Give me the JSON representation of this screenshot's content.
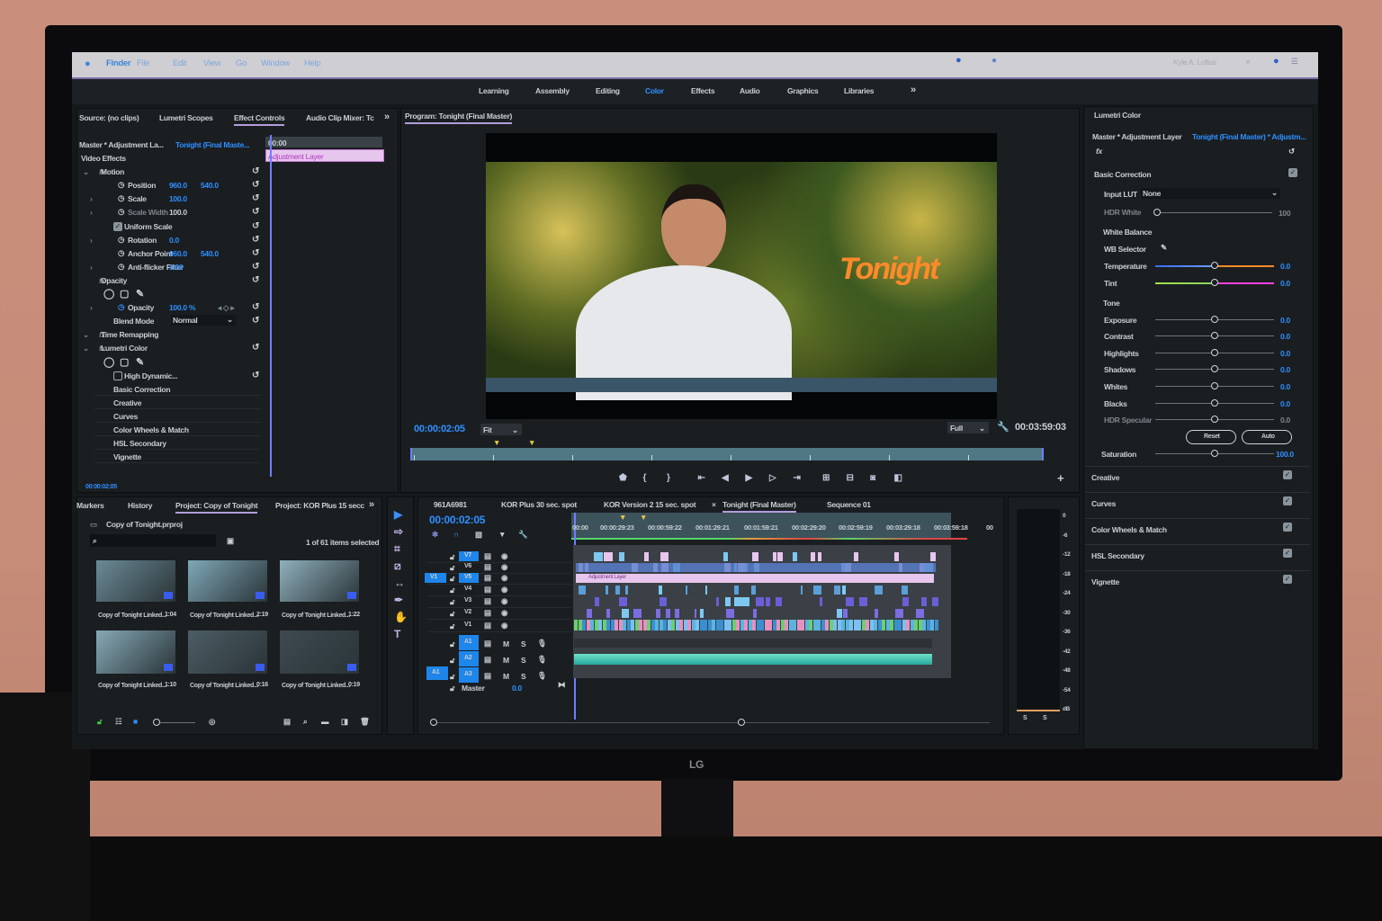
{
  "menubar": {
    "apple": "",
    "items": [
      "Finder",
      "File",
      "Edit",
      "View",
      "Go",
      "Window",
      "Help"
    ],
    "user": "Kyle A. Loftus"
  },
  "workspaces": {
    "items": [
      "Learning",
      "Assembly",
      "Editing",
      "Color",
      "Effects",
      "Audio",
      "Graphics",
      "Libraries"
    ],
    "active": "Color",
    "more": "»"
  },
  "effect_controls": {
    "tabs": [
      "Source: (no clips)",
      "Lumetri Scopes",
      "Effect Controls",
      "Audio Clip Mixer: Tc"
    ],
    "more": "»",
    "master": "Master * Adjustment La...",
    "clip": "Tonight (Final Maste...",
    "ruler_time": "00:00",
    "clip_label": "Adjustment Layer",
    "rows": [
      {
        "label": "Video Effects",
        "indent": 0
      },
      {
        "label": "Motion",
        "indent": 1,
        "fx": true
      },
      {
        "label": "Position",
        "indent": 2,
        "v1": "960.0",
        "v2": "540.0"
      },
      {
        "label": "Scale",
        "indent": 2,
        "v1": "100.0"
      },
      {
        "label": "Scale Width",
        "indent": 2,
        "v1": "100.0",
        "dim": true
      },
      {
        "label": "Uniform Scale",
        "indent": 4,
        "check": true
      },
      {
        "label": "Rotation",
        "indent": 2,
        "v1": "0.0"
      },
      {
        "label": "Anchor Point",
        "indent": 2,
        "v1": "960.0",
        "v2": "540.0"
      },
      {
        "label": "Anti-flicker Filter",
        "indent": 2,
        "v1": "0.00"
      },
      {
        "label": "Opacity",
        "indent": 1,
        "fx": true
      },
      {
        "label": "",
        "indent": 2,
        "masks": true
      },
      {
        "label": "Opacity",
        "indent": 2,
        "v1": "100.0 %"
      },
      {
        "label": "Blend Mode",
        "indent": 3,
        "select": "Normal"
      },
      {
        "label": "Time Remapping",
        "indent": 1,
        "fx": true
      },
      {
        "label": "Lumetri Color",
        "indent": 1,
        "fx": true
      },
      {
        "label": "",
        "indent": 2,
        "masks": true
      },
      {
        "label": "High Dynamic...",
        "indent": 4,
        "check": false
      },
      {
        "label": "Basic Correction",
        "indent": 3
      },
      {
        "label": "Creative",
        "indent": 3
      },
      {
        "label": "Curves",
        "indent": 3
      },
      {
        "label": "Color Wheels & Match",
        "indent": 3
      },
      {
        "label": "HSL Secondary",
        "indent": 3
      },
      {
        "label": "Vignette",
        "indent": 3
      }
    ],
    "timecode": "00:00:02:05"
  },
  "program": {
    "title": "Program: Tonight (Final Master)",
    "overlay_text": "Tonight",
    "timecode": "00:00:02:05",
    "fit": "Fit",
    "quality": "Full",
    "duration": "00:03:59:03",
    "controls": [
      "marker-icon",
      "mark-in-icon",
      "mark-out-icon",
      "go-to-in-icon",
      "step-back-icon",
      "play-icon",
      "step-forward-icon",
      "go-to-out-icon",
      "lift-icon",
      "extract-icon",
      "export-frame-icon",
      "compare-icon"
    ],
    "add": "+"
  },
  "lumetri": {
    "title": "Lumetri Color",
    "master": "Master * Adjustment Layer",
    "clip": "Tonight (Final Master) * Adjustm...",
    "fx": "fx",
    "basic": "Basic Correction",
    "input_lut_label": "Input LUT",
    "input_lut": "None",
    "hdr_white_label": "HDR White",
    "hdr_white": "100",
    "white_balance": "White Balance",
    "wb_selector": "WB Selector",
    "sliders": [
      {
        "label": "Temperature",
        "value": "0.0",
        "kind": "temp"
      },
      {
        "label": "Tint",
        "value": "0.0",
        "kind": "tint"
      },
      {
        "label": "Exposure",
        "value": "0.0"
      },
      {
        "label": "Contrast",
        "value": "0.0"
      },
      {
        "label": "Highlights",
        "value": "0.0"
      },
      {
        "label": "Shadows",
        "value": "0.0"
      },
      {
        "label": "Whites",
        "value": "0.0"
      },
      {
        "label": "Blacks",
        "value": "0.0"
      },
      {
        "label": "HDR Specular",
        "value": "0.0",
        "dim": true
      },
      {
        "label": "Saturation",
        "value": "100.0"
      }
    ],
    "tone": "Tone",
    "reset": "Reset",
    "auto": "Auto",
    "sections": [
      "Creative",
      "Curves",
      "Color Wheels & Match",
      "HSL Secondary",
      "Vignette"
    ]
  },
  "project": {
    "tabs": [
      "Markers",
      "History",
      "Project: Copy of Tonight",
      "Project: KOR Plus 15 secc"
    ],
    "more": "»",
    "file": "Copy of Tonight.prproj",
    "search_placeholder": "",
    "selected": "1 of 61 items selected",
    "items": [
      {
        "name": "Copy of Tonight Linked...",
        "dur": "1:04"
      },
      {
        "name": "Copy of Tonight Linked...",
        "dur": "2:19"
      },
      {
        "name": "Copy of Tonight Linked...",
        "dur": "1:22"
      },
      {
        "name": "Copy of Tonight Linked...",
        "dur": "1:10"
      },
      {
        "name": "Copy of Tonight Linked...",
        "dur": "0:16"
      },
      {
        "name": "Copy of Tonight Linked...",
        "dur": "0:19"
      }
    ]
  },
  "timeline": {
    "tabs": [
      "961A6981",
      "KOR Plus 30 sec. spot",
      "KOR Version 2 15 sec. spot",
      "Tonight (Final Master)",
      "Sequence 01"
    ],
    "active": "Tonight (Final Master)",
    "close": "×",
    "timecode": "00:00:02:05",
    "ruler": [
      "00:00",
      "00:00:29:23",
      "00:00:59:22",
      "00:01:29:21",
      "00:01:59:21",
      "00:02:29:20",
      "00:02:59:19",
      "00:03:29:18",
      "00:03:59:18",
      "00"
    ],
    "video_tracks": [
      "V7",
      "V6",
      "V5",
      "V4",
      "V3",
      "V2",
      "V1"
    ],
    "audio_tracks": [
      "A1",
      "A2",
      "A3"
    ],
    "source_v": "V1",
    "source_a": "A1",
    "mute": "M",
    "solo": "S",
    "master_label": "Master",
    "master_value": "0.0",
    "adjustment_clip": "Adjustment Layer"
  },
  "meter": {
    "scale": [
      "0",
      "-6",
      "-12",
      "-18",
      "-24",
      "-30",
      "-36",
      "-42",
      "-48",
      "-54",
      "dB"
    ],
    "solo": [
      "S",
      "S"
    ]
  },
  "monitor_brand": "LG",
  "colors": {
    "accent": "#2f8fff",
    "panel": "#1a1e21",
    "overlay_text": "#ff8a2a",
    "adjustment": "#e7c6ee"
  }
}
